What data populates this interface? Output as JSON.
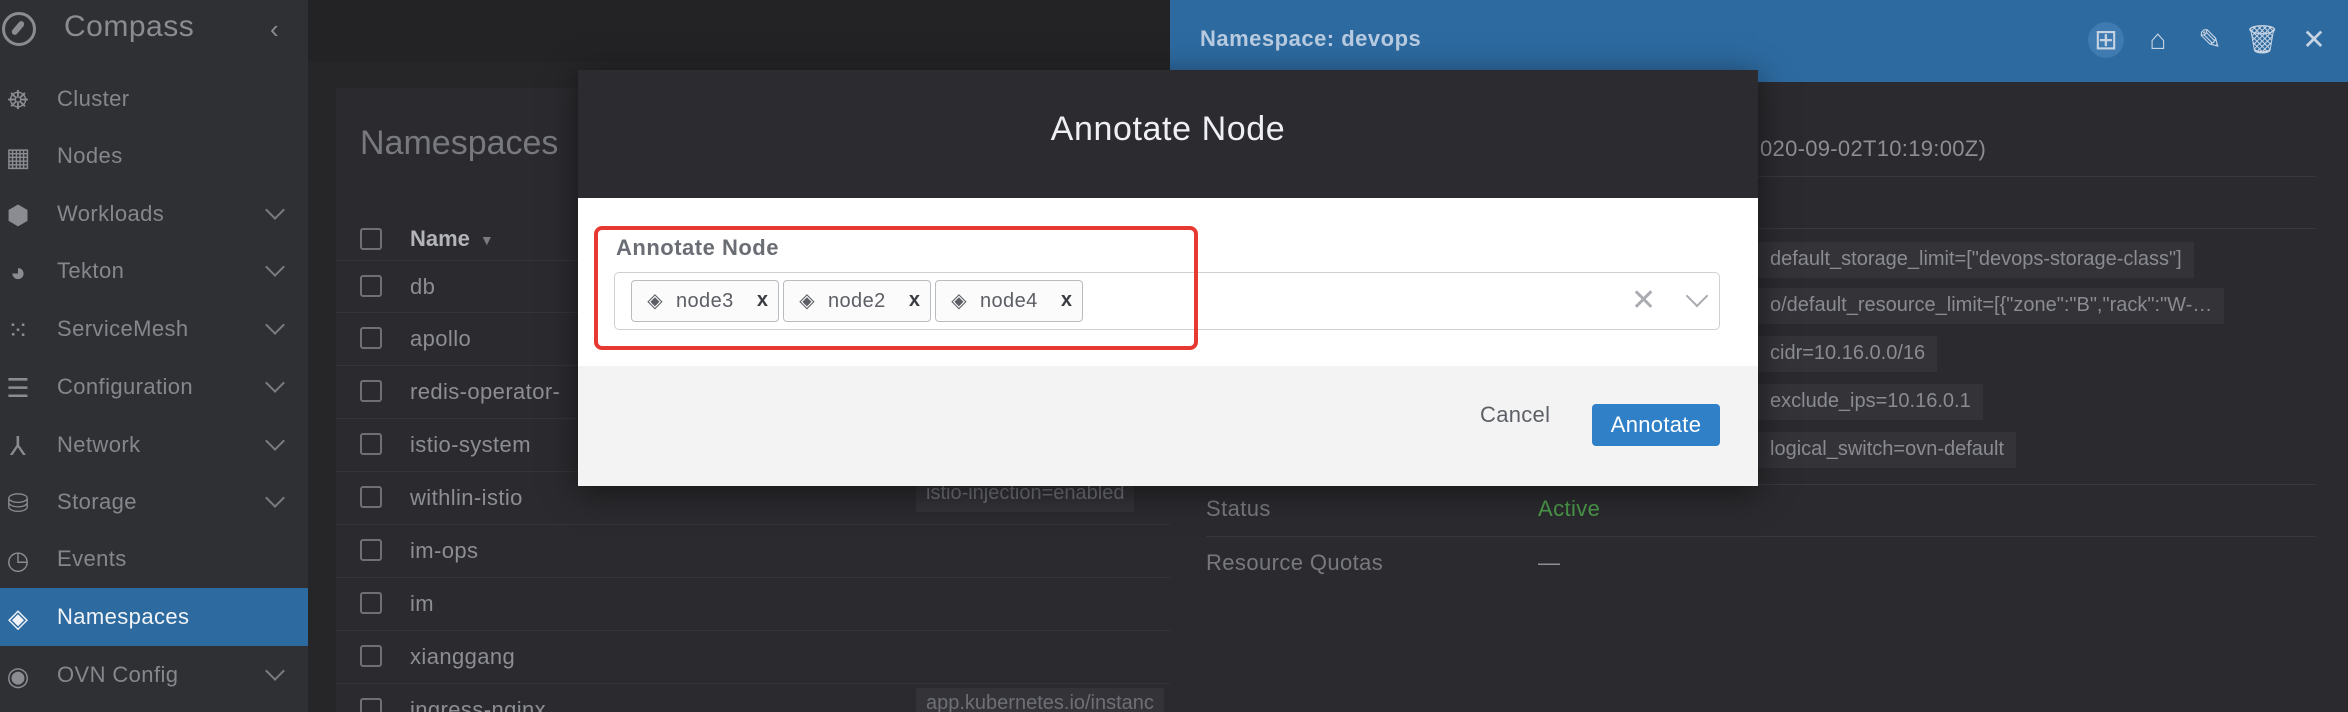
{
  "app": {
    "title": "Compass"
  },
  "sidebar": {
    "items": [
      {
        "label": "Cluster",
        "icon": "helm-wheel-icon"
      },
      {
        "label": "Nodes",
        "icon": "server-rack-icon"
      },
      {
        "label": "Workloads",
        "icon": "cubes-icon",
        "expandable": true
      },
      {
        "label": "Tekton",
        "icon": "palette-icon",
        "expandable": true
      },
      {
        "label": "ServiceMesh",
        "icon": "grid-dots-icon",
        "expandable": true
      },
      {
        "label": "Configuration",
        "icon": "list-icon",
        "expandable": true
      },
      {
        "label": "Network",
        "icon": "network-icon",
        "expandable": true
      },
      {
        "label": "Storage",
        "icon": "database-icon",
        "expandable": true
      },
      {
        "label": "Events",
        "icon": "clock-icon"
      },
      {
        "label": "Namespaces",
        "icon": "layers-icon",
        "active": true
      },
      {
        "label": "OVN Config",
        "icon": "satellite-icon",
        "expandable": true
      }
    ]
  },
  "namespaces": {
    "title": "Namespaces",
    "column_name": "Name",
    "rows": [
      {
        "name": "db"
      },
      {
        "name": "apollo"
      },
      {
        "name": "redis-operator-"
      },
      {
        "name": "istio-system"
      },
      {
        "name": "withlin-istio"
      },
      {
        "name": "im-ops"
      },
      {
        "name": "im"
      },
      {
        "name": "xianggang"
      },
      {
        "name": "ingress-nginx"
      }
    ],
    "row_labels": {
      "withlin_istio": "istio-injection=enabled",
      "ingress_nginx": "app.kubernetes.io/instanc"
    }
  },
  "drawer": {
    "title": "Namespace: devops",
    "created_fragment": "020-09-02T10:19:00Z)",
    "annotations": [
      "default_storage_limit=[\"devops-storage-class\"]",
      "o/default_resource_limit=[{\"zone\":\"B\",\"rack\":\"W-…",
      "cidr=10.16.0.0/16",
      "exclude_ips=10.16.0.1",
      "logical_switch=ovn-default"
    ],
    "status_label": "Status",
    "status_value": "Active",
    "quotas_label": "Resource Quotas",
    "quotas_value": "—"
  },
  "modal": {
    "title": "Annotate Node",
    "field_label": "Annotate Node",
    "selected_tags": [
      "node3",
      "node2",
      "node4"
    ],
    "tag_remove": "x",
    "clear_symbol": "✕",
    "cancel_label": "Cancel",
    "submit_label": "Annotate"
  },
  "colors": {
    "accent": "#2d6aa0",
    "primary_button": "#2f80c7",
    "highlight": "#e63a30",
    "status_active": "#4a9a4a"
  }
}
